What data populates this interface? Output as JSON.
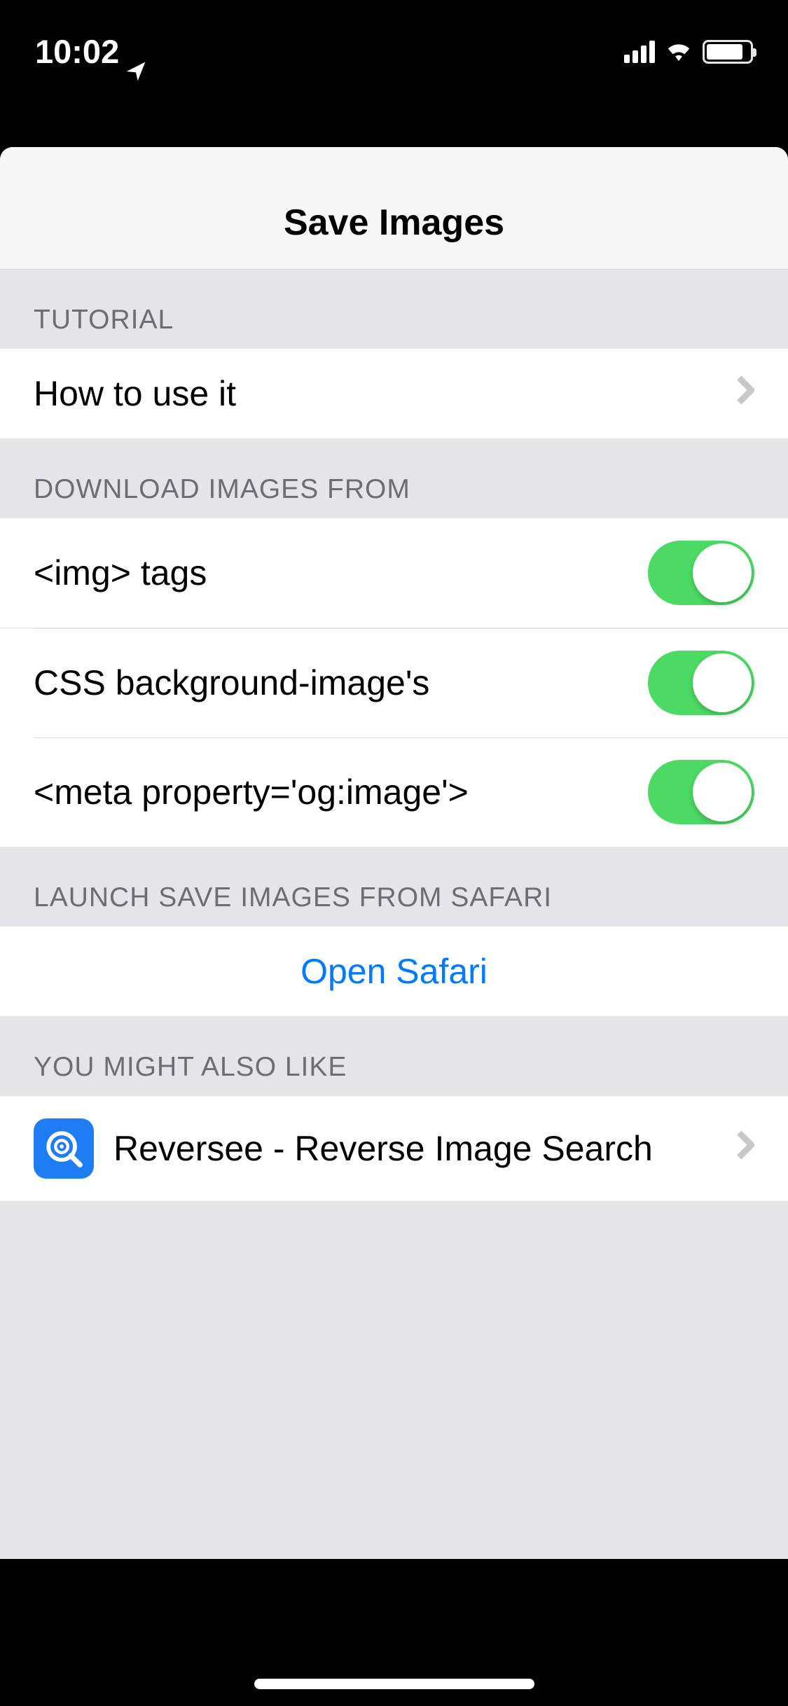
{
  "statusBar": {
    "time": "10:02"
  },
  "header": {
    "title": "Save Images"
  },
  "sections": {
    "tutorial": {
      "header": "TUTORIAL",
      "rows": [
        {
          "label": "How to use it"
        }
      ]
    },
    "download": {
      "header": "DOWNLOAD IMAGES FROM",
      "rows": [
        {
          "label": "<img> tags",
          "enabled": true
        },
        {
          "label": "CSS background-image's",
          "enabled": true
        },
        {
          "label": "<meta property='og:image'>",
          "enabled": true
        }
      ]
    },
    "launch": {
      "header": "LAUNCH SAVE IMAGES FROM SAFARI",
      "rows": [
        {
          "label": "Open Safari"
        }
      ]
    },
    "recommend": {
      "header": "YOU MIGHT ALSO LIKE",
      "rows": [
        {
          "label": "Reversee - Reverse Image Search"
        }
      ]
    }
  }
}
